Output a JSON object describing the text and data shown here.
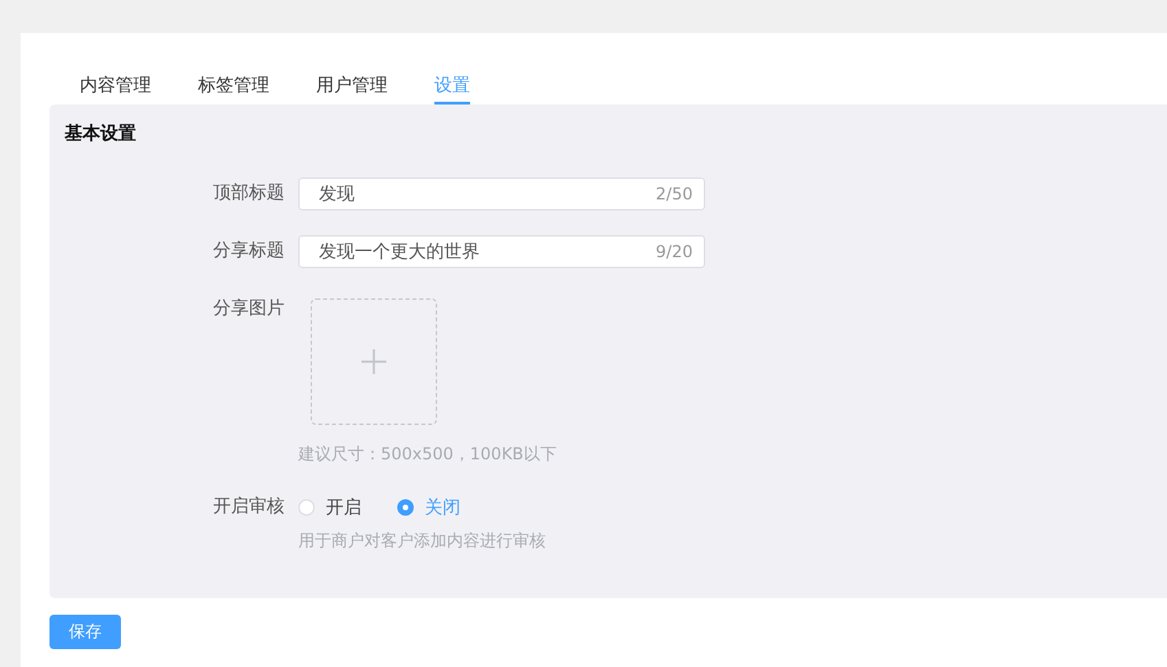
{
  "tabs": [
    {
      "label": "内容管理",
      "selected": false
    },
    {
      "label": "标签管理",
      "selected": false
    },
    {
      "label": "用户管理",
      "selected": false
    },
    {
      "label": "设置",
      "selected": true
    }
  ],
  "section_title": "基本设置",
  "fields": [
    {
      "kind": "text",
      "label": "顶部标题",
      "value": "发现",
      "count": "2/50"
    },
    {
      "kind": "text",
      "label": "分享标题",
      "value": "发现一个更大的世界",
      "count": "9/20"
    },
    {
      "kind": "upload",
      "label": "分享图片",
      "hint": "建议尺寸：500x500，100KB以下"
    },
    {
      "kind": "radio",
      "label": "开启审核",
      "options": [
        {
          "label": "开启",
          "selected": false
        },
        {
          "label": "关闭",
          "selected": true
        }
      ],
      "hint": "用于商户对客户添加内容进行审核"
    }
  ],
  "save_button": "保存"
}
